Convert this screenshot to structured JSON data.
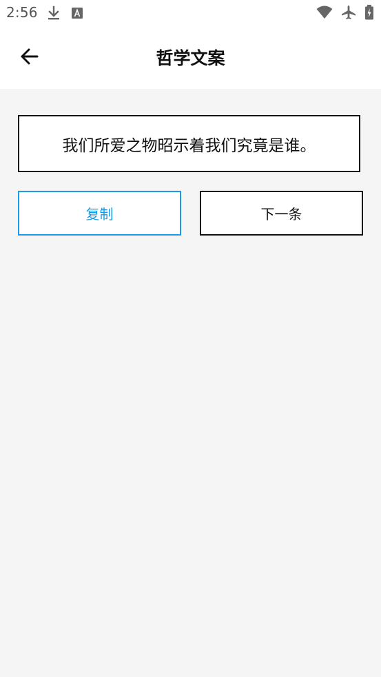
{
  "status_bar": {
    "time": "2:56",
    "left_icons": [
      "download-icon",
      "font-a-icon"
    ],
    "right_icons": [
      "wifi-icon",
      "airplane-icon",
      "battery-icon"
    ]
  },
  "app_bar": {
    "title": "哲学文案",
    "back_icon": "arrow-left-icon"
  },
  "quote": {
    "text": "我们所爱之物昭示着我们究竟是谁。"
  },
  "actions": {
    "copy_label": "复制",
    "next_label": "下一条"
  },
  "colors": {
    "accent": "#1a9be6",
    "background": "#f5f5f5",
    "surface": "#ffffff",
    "text": "#111111"
  }
}
